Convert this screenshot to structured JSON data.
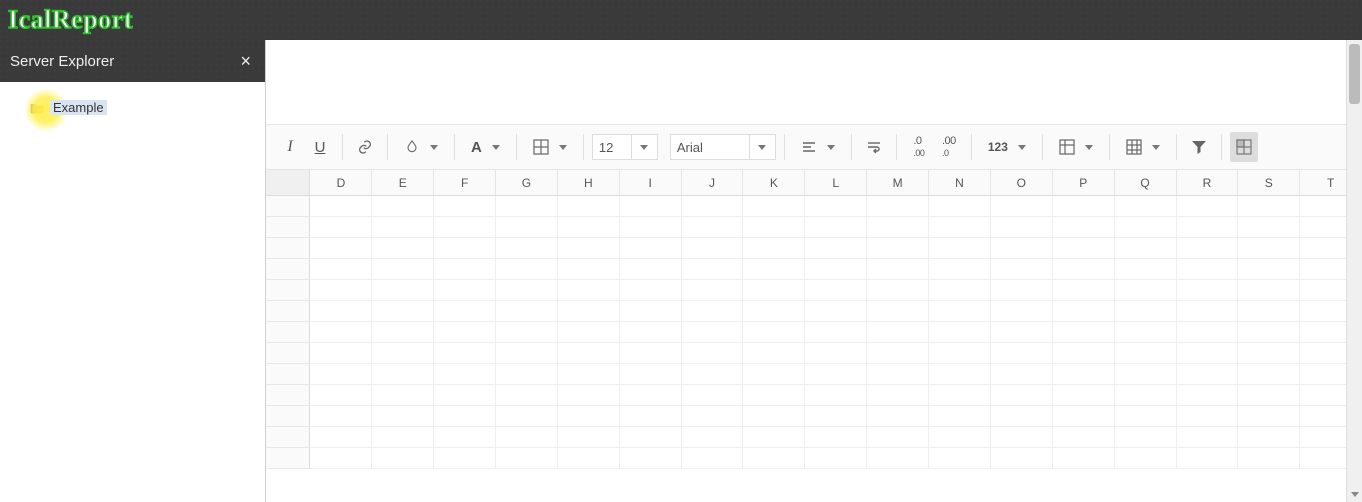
{
  "app": {
    "title": "IcalReport"
  },
  "sidebar": {
    "title": "Server Explorer",
    "close_glyph": "×",
    "items": [
      {
        "label": "Example"
      }
    ]
  },
  "toolbar": {
    "font_size": "12",
    "font_name": "Arial",
    "number_label": "123",
    "font_color_letter": "A"
  },
  "sheet": {
    "columns": [
      "D",
      "E",
      "F",
      "G",
      "H",
      "I",
      "J",
      "K",
      "L",
      "M",
      "N",
      "O",
      "P",
      "Q",
      "R",
      "S",
      "T"
    ],
    "row_count": 13
  }
}
